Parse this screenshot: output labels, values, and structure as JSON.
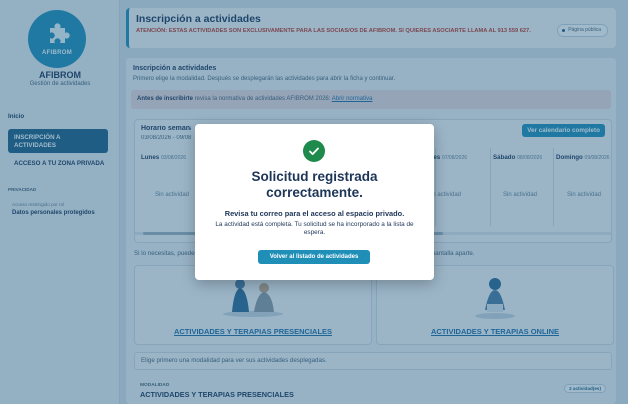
{
  "sidebar": {
    "logo_text": "AFIBROM",
    "brand": "AFIBROM",
    "brand_sub": "Gestión de actividades",
    "items": [
      {
        "label": "Inicio"
      },
      {
        "label": "INSCRIPCIÓN A ACTIVIDADES"
      },
      {
        "label": "ACCESO A TU ZONA PRIVADA"
      }
    ],
    "section_label": "PRIVACIDAD",
    "section_small": "Acceso restringido por rol",
    "section_link": "Datos personales protegidos"
  },
  "header": {
    "title": "Inscripción a actividades",
    "warning": "ATENCIÓN: ESTAS ACTIVIDADES SON EXCLUSIVAMENTE PARA LAS SOCIAS/OS DE AFIBROM. SI QUIERES ASOCIARTE LLAMA AL 913 559 627.",
    "public_pill": "Página pública"
  },
  "main": {
    "section_title": "Inscripción a actividades",
    "section_sub": "Primero elige la modalidad. Después se desplegarán las actividades para abrir la ficha y continuar.",
    "notice_strong": "Antes de inscribirte",
    "notice_text": " revisa la normativa de actividades AFIBROM 2026: ",
    "notice_link": "Abrir normativa",
    "schedule": {
      "title": "Horario semanal",
      "dates": "03/08/2026 - 09/08/2026",
      "calendar_button": "Ver calendario completo",
      "days": [
        {
          "name": "Lunes",
          "date": "03/08/2026",
          "empty": "Sin actividad"
        },
        {
          "name": "Viernes",
          "date": "07/08/2026",
          "empty": "Sin actividad"
        },
        {
          "name": "Sábado",
          "date": "08/08/2026",
          "empty": "Sin actividad"
        },
        {
          "name": "Domingo",
          "date": "09/08/2026",
          "empty": "Sin actividad"
        }
      ]
    },
    "helper": "Si lo necesitas, puedes desplegar la modalidad y pulsar en la actividad para abrir la ficha y continuar en una pantalla aparte.",
    "modalities": [
      {
        "label": "ACTIVIDADES Y TERAPIAS PRESENCIALES"
      },
      {
        "label": "ACTIVIDADES Y TERAPIAS ONLINE"
      }
    ],
    "hint": "Elige primero una modalidad para ver sus actividades desplegadas.",
    "modality_kicker": "MODALIDAD",
    "modality_title": "ACTIVIDADES Y TERAPIAS PRESENCIALES",
    "count_pill": "2 actividad(es)"
  },
  "modal": {
    "title_line1": "Solicitud registrada",
    "title_line2": "correctamente.",
    "strong": "Revisa tu correo para el acceso al espacio privado.",
    "text": "La actividad está completa. Tu solicitud se ha incorporado a la lista de espera.",
    "button": "Volver al listado de actividades"
  },
  "colors": {
    "accent": "#1f8fb8",
    "nav_active": "#1f5f86",
    "success": "#1e8a4c",
    "warning": "#c0392b"
  }
}
